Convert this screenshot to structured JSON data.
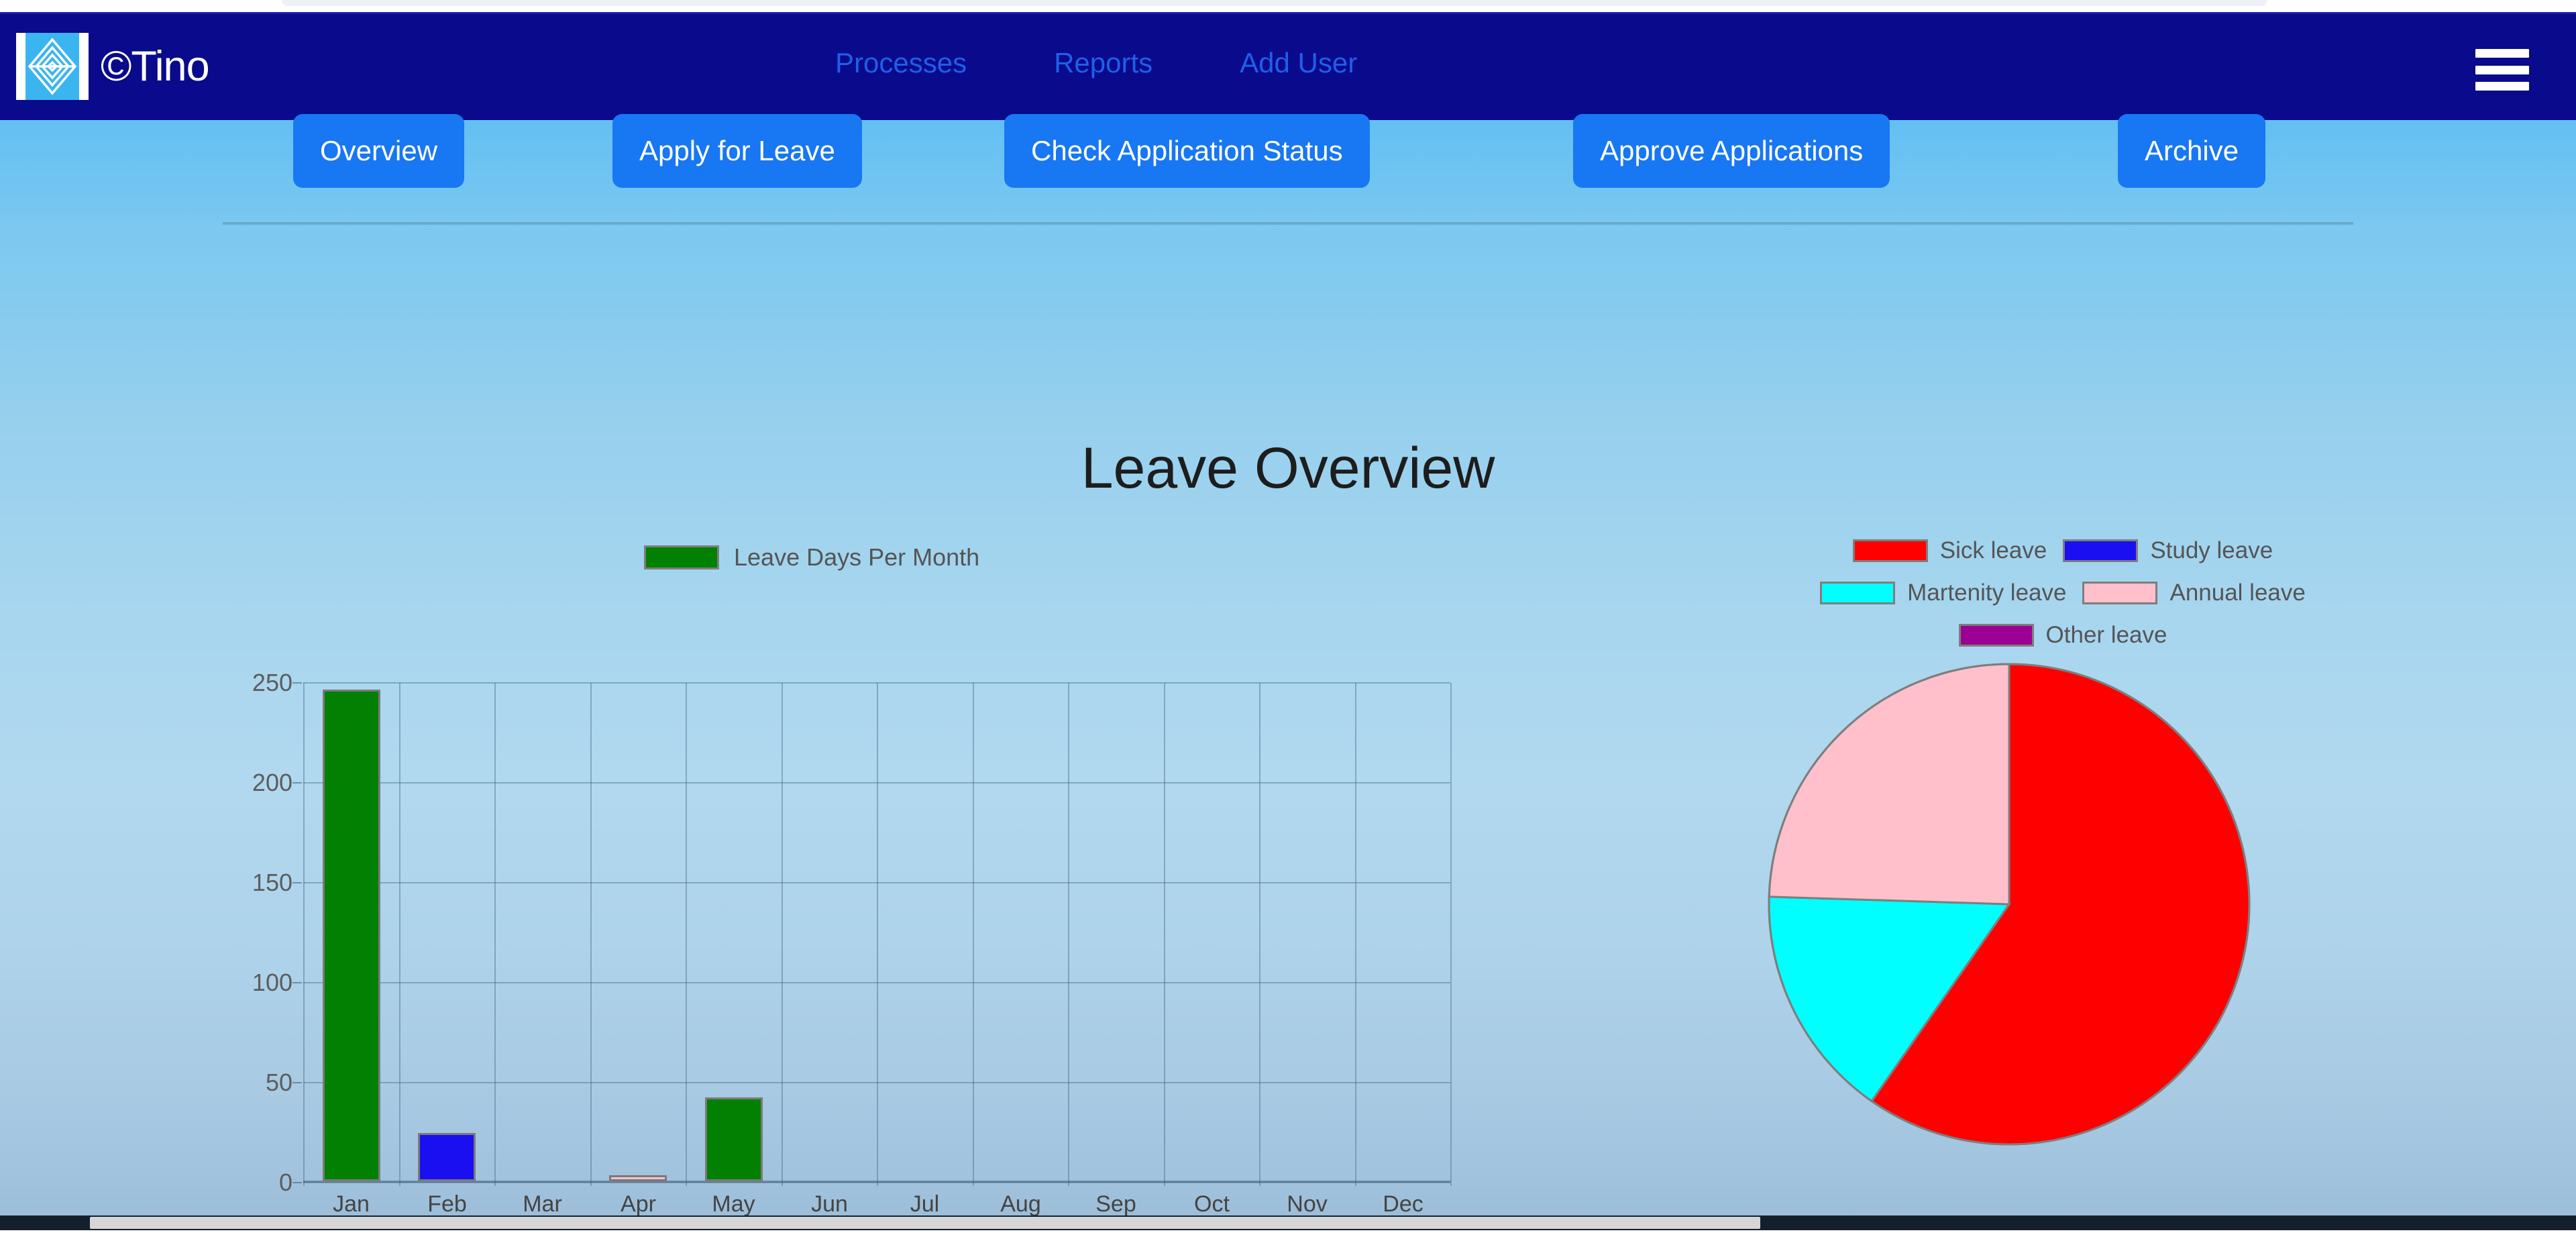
{
  "browser": {
    "scrollbar_present": true
  },
  "navbar": {
    "brand_label": "©Tino",
    "logo_icon": "tino-diamond-logo-icon",
    "links": [
      {
        "label": "Processes",
        "name": "nav-link-processes"
      },
      {
        "label": "Reports",
        "name": "nav-link-reports"
      },
      {
        "label": "Add User",
        "name": "nav-link-add-user"
      }
    ],
    "menu_icon": "hamburger-menu-icon",
    "background_color": "#0a0a8c",
    "link_color": "#1f5fe8"
  },
  "tabs": [
    {
      "label": "Overview"
    },
    {
      "label": "Apply for Leave"
    },
    {
      "label": "Check Application Status"
    },
    {
      "label": "Approve Applications"
    },
    {
      "label": "Archive"
    }
  ],
  "tab_button_color": "#1877f2",
  "page": {
    "title": "Leave Overview"
  },
  "chart_data": [
    {
      "type": "bar",
      "name": "leave-days-per-month-bar-chart",
      "title": "",
      "xlabel": "",
      "ylabel": "",
      "legend": [
        {
          "label": "Leave Days Per Month",
          "color": "#018001"
        }
      ],
      "legend_position": "top-center",
      "grid": true,
      "ylim": [
        0,
        250
      ],
      "yticks": [
        250,
        200,
        150,
        100,
        50,
        0
      ],
      "categories": [
        "Jan",
        "Feb",
        "Mar",
        "Apr",
        "May",
        "Jun",
        "Jul",
        "Aug",
        "Sep",
        "Oct",
        "Nov",
        "Dec"
      ],
      "values": [
        246,
        24,
        0,
        3,
        42,
        0,
        0,
        0,
        0,
        0,
        0,
        0
      ],
      "bar_colors": [
        "#018001",
        "#1a0ff0",
        "#018001",
        "#ffc0cb",
        "#018001",
        "#018001",
        "#018001",
        "#018001",
        "#018001",
        "#018001",
        "#018001",
        "#018001"
      ]
    },
    {
      "type": "pie",
      "name": "leave-type-distribution-pie-chart",
      "title": "",
      "legend_position": "top",
      "labels": [
        "Sick leave",
        "Study leave",
        "Martenity leave",
        "Annual leave",
        "Other leave"
      ],
      "colors": [
        "#ff0000",
        "#1a0ff0",
        "#00ffff",
        "#ffc0cb",
        "#9c0094"
      ],
      "values": [
        59.7,
        0,
        15.8,
        24.5,
        0
      ],
      "start_angle_deg": 0,
      "direction": "clockwise"
    }
  ]
}
